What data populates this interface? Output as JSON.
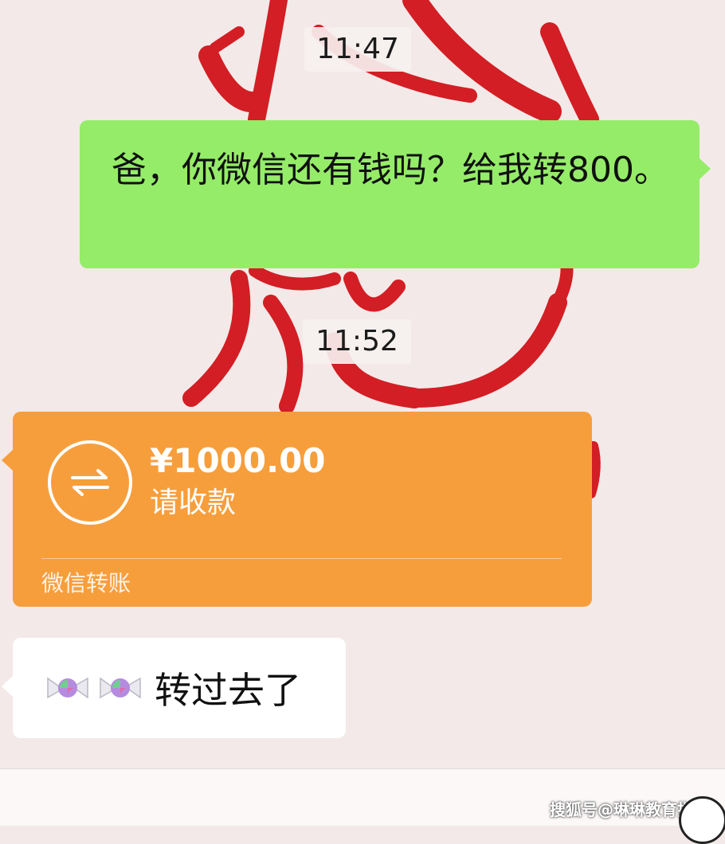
{
  "chat": {
    "timestamps": [
      "11:47",
      "11:52"
    ],
    "outgoing_message": "爸，你微信还有钱吗？给我转800。",
    "transfer": {
      "amount": "¥1000.00",
      "status": "请收款",
      "footer": "微信转账",
      "icon": "transfer-arrows-icon"
    },
    "incoming_message": {
      "emoji": [
        "candy-icon",
        "candy-icon"
      ],
      "text": "转过去了"
    }
  },
  "watermark": "搜狐号@琳琳教育指南",
  "colors": {
    "outgoing_bubble": "#95ec69",
    "transfer_card": "#f79e3c",
    "incoming_bubble": "#ffffff",
    "wallpaper_calligraphy": "#d21e24",
    "background": "#f3e9e8"
  }
}
